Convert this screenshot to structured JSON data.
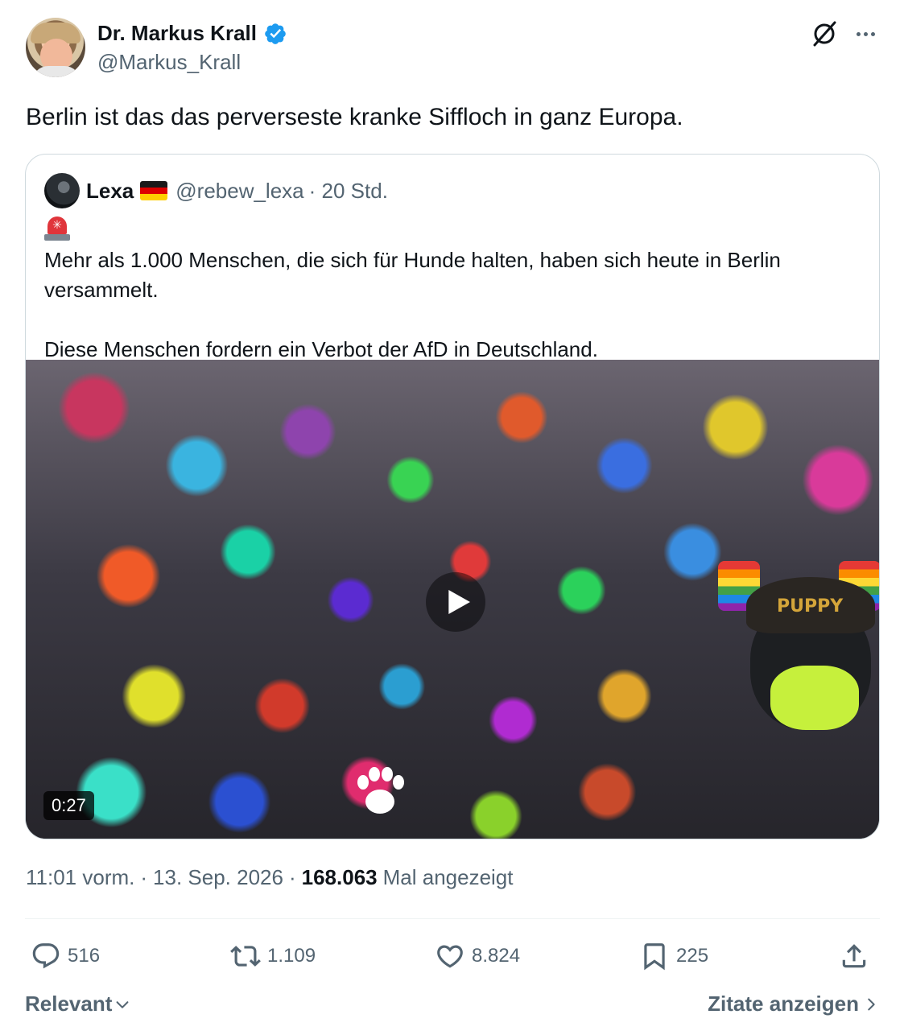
{
  "author": {
    "display_name": "Dr. Markus Krall",
    "handle": "@Markus_Krall"
  },
  "tweet": {
    "text": "Berlin ist das das perverseste kranke Siffloch in ganz Europa."
  },
  "quoted_tweet": {
    "display_name": "Lexa",
    "handle": "@rebew_lexa",
    "time": "· 20 Std.",
    "text_line1": "Mehr als 1.000 Menschen, die sich für Hunde halten, haben sich heute in Berlin versammelt.",
    "text_line2": "Diese Menschen fordern ein Verbot der AfD in Deutschland.",
    "video": {
      "duration": "0:27",
      "overlay_text": "PUPPY"
    }
  },
  "meta": {
    "time": "11:01 vorm.",
    "date": "13. Sep. 2026",
    "views_count": "168.063",
    "views_label": "Mal angezeigt"
  },
  "actions": {
    "replies": "516",
    "reposts": "1.109",
    "likes": "8.824",
    "bookmarks": "225"
  },
  "footer": {
    "sort_label": "Relevant",
    "quotes_label": "Zitate anzeigen"
  },
  "icons": {
    "verified": "verified-badge-icon",
    "grok": "grok-icon",
    "more": "more-icon",
    "reply": "reply-icon",
    "repost": "repost-icon",
    "like": "like-icon",
    "bookmark": "bookmark-icon",
    "share": "share-icon"
  },
  "colors": {
    "verified_blue": "#1d9bf0",
    "secondary_text": "#536471",
    "primary_text": "#0f1419"
  }
}
